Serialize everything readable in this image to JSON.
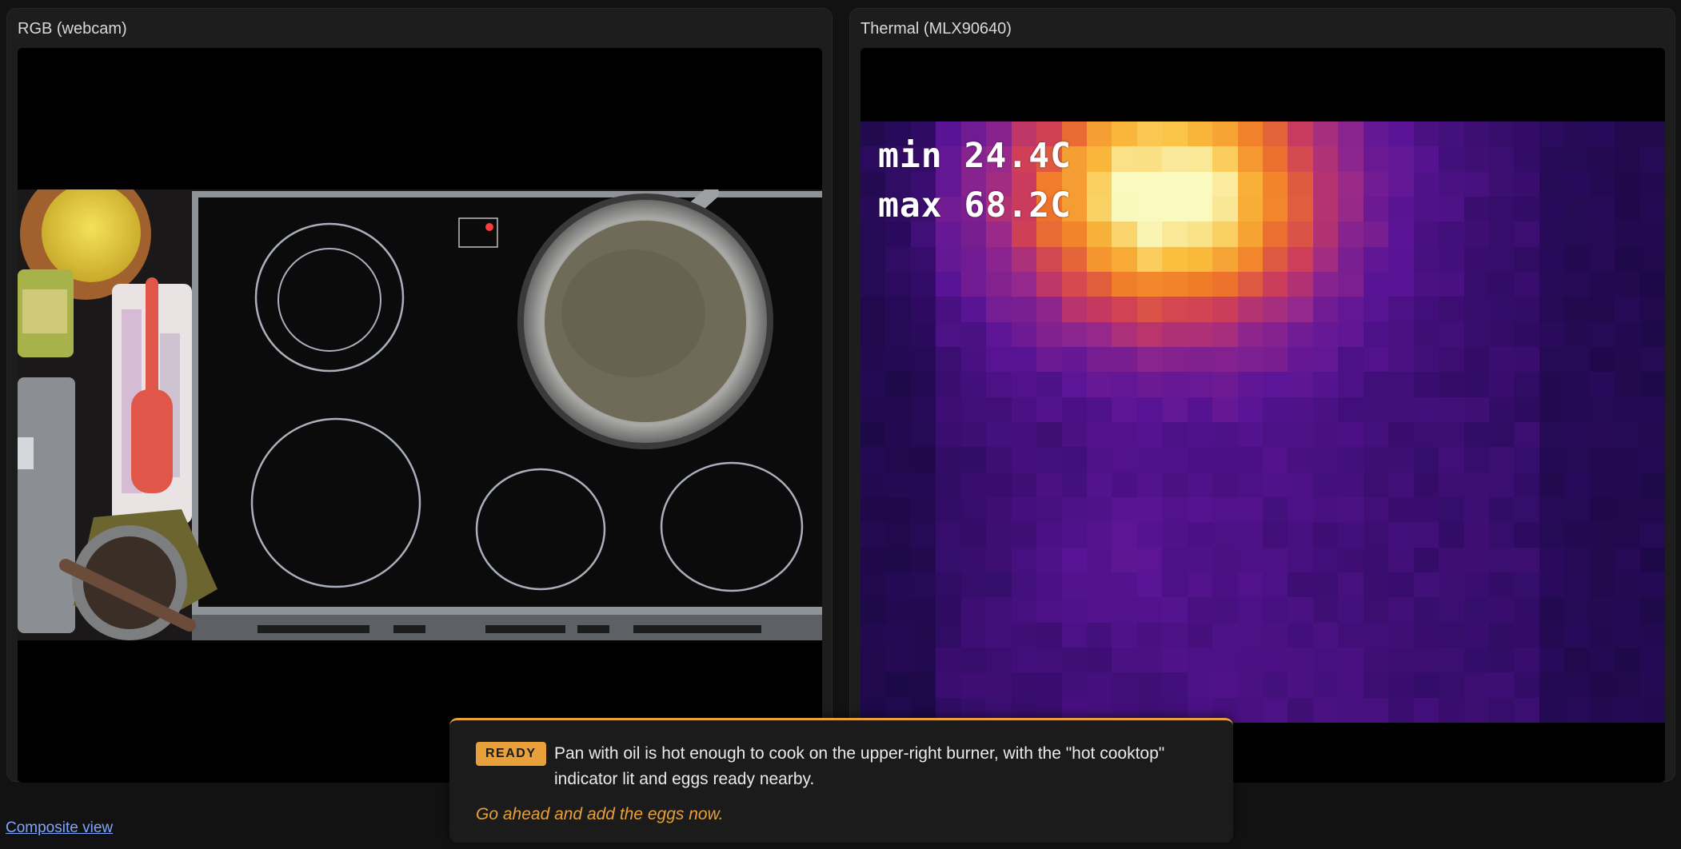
{
  "panels": {
    "rgb": {
      "title": "RGB (webcam)"
    },
    "thermal": {
      "title": "Thermal (MLX90640)",
      "min_label": "min 24.4C",
      "max_label": "max 68.2C"
    }
  },
  "status": {
    "badge": "READY",
    "message": "Pan with oil is hot enough to cook on the upper-right burner, with the \"hot cooktop\" indicator lit and eggs ready nearby.",
    "advice": "Go ahead and add the eggs now.",
    "accent_color": "#e8a13a"
  },
  "footer": {
    "composite_link": "Composite view"
  },
  "icons": {
    "indicator_light": "hot-cooktop-indicator-icon"
  }
}
